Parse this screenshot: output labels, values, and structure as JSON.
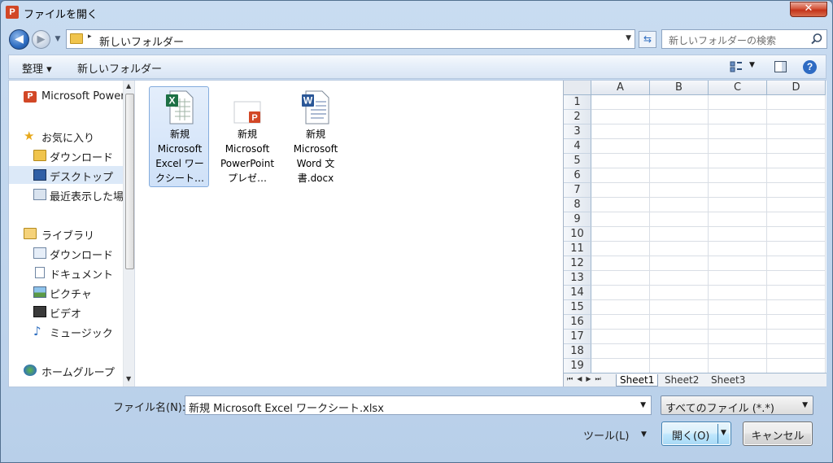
{
  "window": {
    "title": "ファイルを開く",
    "app_icon_letter": "P",
    "close_symbol": "✕"
  },
  "address": {
    "path": "新しいフォルダー",
    "separator": "▸"
  },
  "search": {
    "placeholder": "新しいフォルダーの検索"
  },
  "toolbar": {
    "organize_label": "整理 ▾",
    "new_folder_label": "新しいフォルダー",
    "help_symbol": "?"
  },
  "nav": {
    "items": [
      {
        "label": "Microsoft PowerPoint",
        "icon": "powerpoint-icon"
      },
      {
        "label": "お気に入り",
        "icon": "star-icon"
      },
      {
        "label": "ダウンロード",
        "icon": "download-folder-icon"
      },
      {
        "label": "デスクトップ",
        "icon": "desktop-icon"
      },
      {
        "label": "最近表示した場所",
        "icon": "recent-places-icon"
      },
      {
        "label": "ライブラリ",
        "icon": "library-icon"
      },
      {
        "label": "ダウンロード",
        "icon": "download-folder-icon"
      },
      {
        "label": "ドキュメント",
        "icon": "documents-icon"
      },
      {
        "label": "ピクチャ",
        "icon": "pictures-icon"
      },
      {
        "label": "ビデオ",
        "icon": "video-icon"
      },
      {
        "label": "ミュージック",
        "icon": "music-icon"
      },
      {
        "label": "ホームグループ",
        "icon": "homegroup-icon"
      }
    ]
  },
  "files": [
    {
      "name": "新規 Microsoft Excel ワークシート…",
      "icon": "excel-file-icon",
      "selected": true
    },
    {
      "name": "新規 Microsoft PowerPoint プレゼ…",
      "icon": "powerpoint-file-icon",
      "selected": false
    },
    {
      "name": "新規 Microsoft Word 文書.docx",
      "icon": "word-file-icon",
      "selected": false
    }
  ],
  "preview": {
    "columns": [
      "A",
      "B",
      "C",
      "D"
    ],
    "rows": [
      "1",
      "2",
      "3",
      "4",
      "5",
      "6",
      "7",
      "8",
      "9",
      "10",
      "11",
      "12",
      "13",
      "14",
      "15",
      "16",
      "17",
      "18",
      "19"
    ],
    "sheets": [
      "Sheet1",
      "Sheet2",
      "Sheet3"
    ],
    "sheet_nav": "⏮◀▶⏭"
  },
  "footer": {
    "filename_label": "ファイル名(N):",
    "filename_value": "新規 Microsoft Excel ワークシート.xlsx",
    "filter_value": "すべてのファイル (*.*)",
    "tools_label": "ツール(L)",
    "open_label": "開く(O)",
    "cancel_label": "キャンセル"
  },
  "colors": {
    "accent": "#2d6cc0",
    "selection": "#cfe1f8",
    "powerpoint": "#d24726",
    "excel": "#1d7044",
    "word": "#2b5797"
  }
}
